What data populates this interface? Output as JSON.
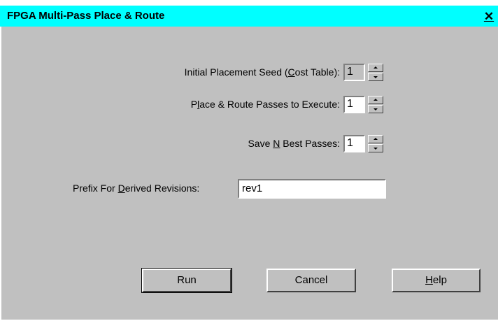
{
  "window": {
    "title": "FPGA Multi-Pass Place & Route",
    "close_glyph": "✕"
  },
  "fields": {
    "seed": {
      "pre": "Initial Placement Seed (",
      "access": "C",
      "post": "ost Table):",
      "value": "1"
    },
    "passes": {
      "pre": "P",
      "access": "l",
      "post": "ace & Route Passes to Execute:",
      "value": "1"
    },
    "best": {
      "pre": "Save ",
      "access": "N",
      "post": " Best Passes:",
      "value": "1"
    },
    "prefix": {
      "pre": "Prefix For ",
      "access": "D",
      "post": "erived Revisions:",
      "value": "rev1"
    }
  },
  "buttons": {
    "run": "Run",
    "cancel": "Cancel",
    "help_access": "H",
    "help_rest": "elp"
  },
  "icons": {
    "close": "close-icon",
    "spin_up": "spin-up-arrow-icon",
    "spin_down": "spin-down-arrow-icon"
  }
}
